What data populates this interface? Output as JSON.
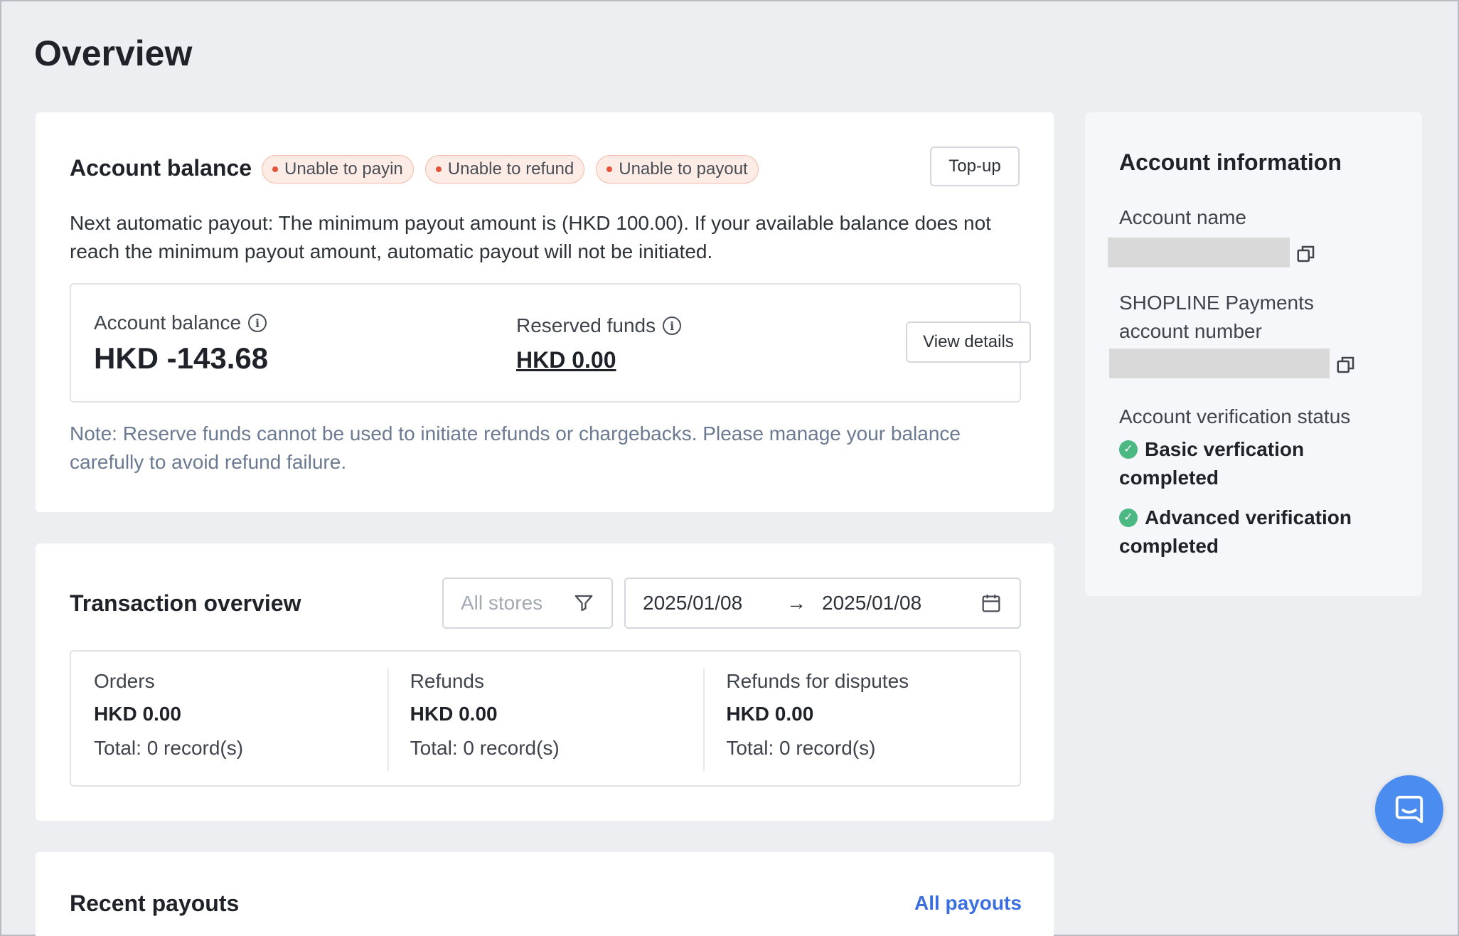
{
  "page": {
    "title": "Overview"
  },
  "account_balance_card": {
    "title": "Account balance",
    "tags": [
      {
        "label": "Unable to payin"
      },
      {
        "label": "Unable to refund"
      },
      {
        "label": "Unable to payout"
      }
    ],
    "topup_label": "Top-up",
    "payout_notice": "Next automatic payout: The minimum payout amount is (HKD 100.00). If your available balance does not reach the minimum payout amount, automatic payout will not be initiated.",
    "balance": {
      "label": "Account balance",
      "value": "HKD -143.68"
    },
    "reserved": {
      "label": "Reserved funds",
      "value": "HKD 0.00"
    },
    "view_details_label": "View details",
    "note": "Note: Reserve funds cannot be used to initiate refunds or chargebacks. Please manage your balance carefully to avoid refund failure."
  },
  "transaction_card": {
    "title": "Transaction overview",
    "store_filter_placeholder": "All stores",
    "date_start": "2025/01/08",
    "date_end": "2025/01/08",
    "stats": [
      {
        "label": "Orders",
        "value": "HKD 0.00",
        "total": "Total: 0 record(s)"
      },
      {
        "label": "Refunds",
        "value": "HKD 0.00",
        "total": "Total: 0 record(s)"
      },
      {
        "label": "Refunds for disputes",
        "value": "HKD 0.00",
        "total": "Total: 0 record(s)"
      }
    ]
  },
  "payouts_card": {
    "title": "Recent payouts",
    "all_payouts_label": "All payouts"
  },
  "account_info": {
    "title": "Account information",
    "account_name_label": "Account name",
    "account_number_label": "SHOPLINE Payments account number",
    "verification_label": "Account verification status",
    "verifications": [
      {
        "label": "Basic verfication completed"
      },
      {
        "label": "Advanced verification completed"
      }
    ]
  },
  "colors": {
    "background": "#eceef2",
    "tag_bg": "#fdece6",
    "tag_dot": "#e5533b",
    "link": "#3b6fe0",
    "success": "#4cb884",
    "chat": "#4a8cf0"
  },
  "icons": [
    "info-icon",
    "filter-icon",
    "arrow-right-icon",
    "calendar-icon",
    "copy-icon",
    "check-circle-icon",
    "chat-icon"
  ]
}
